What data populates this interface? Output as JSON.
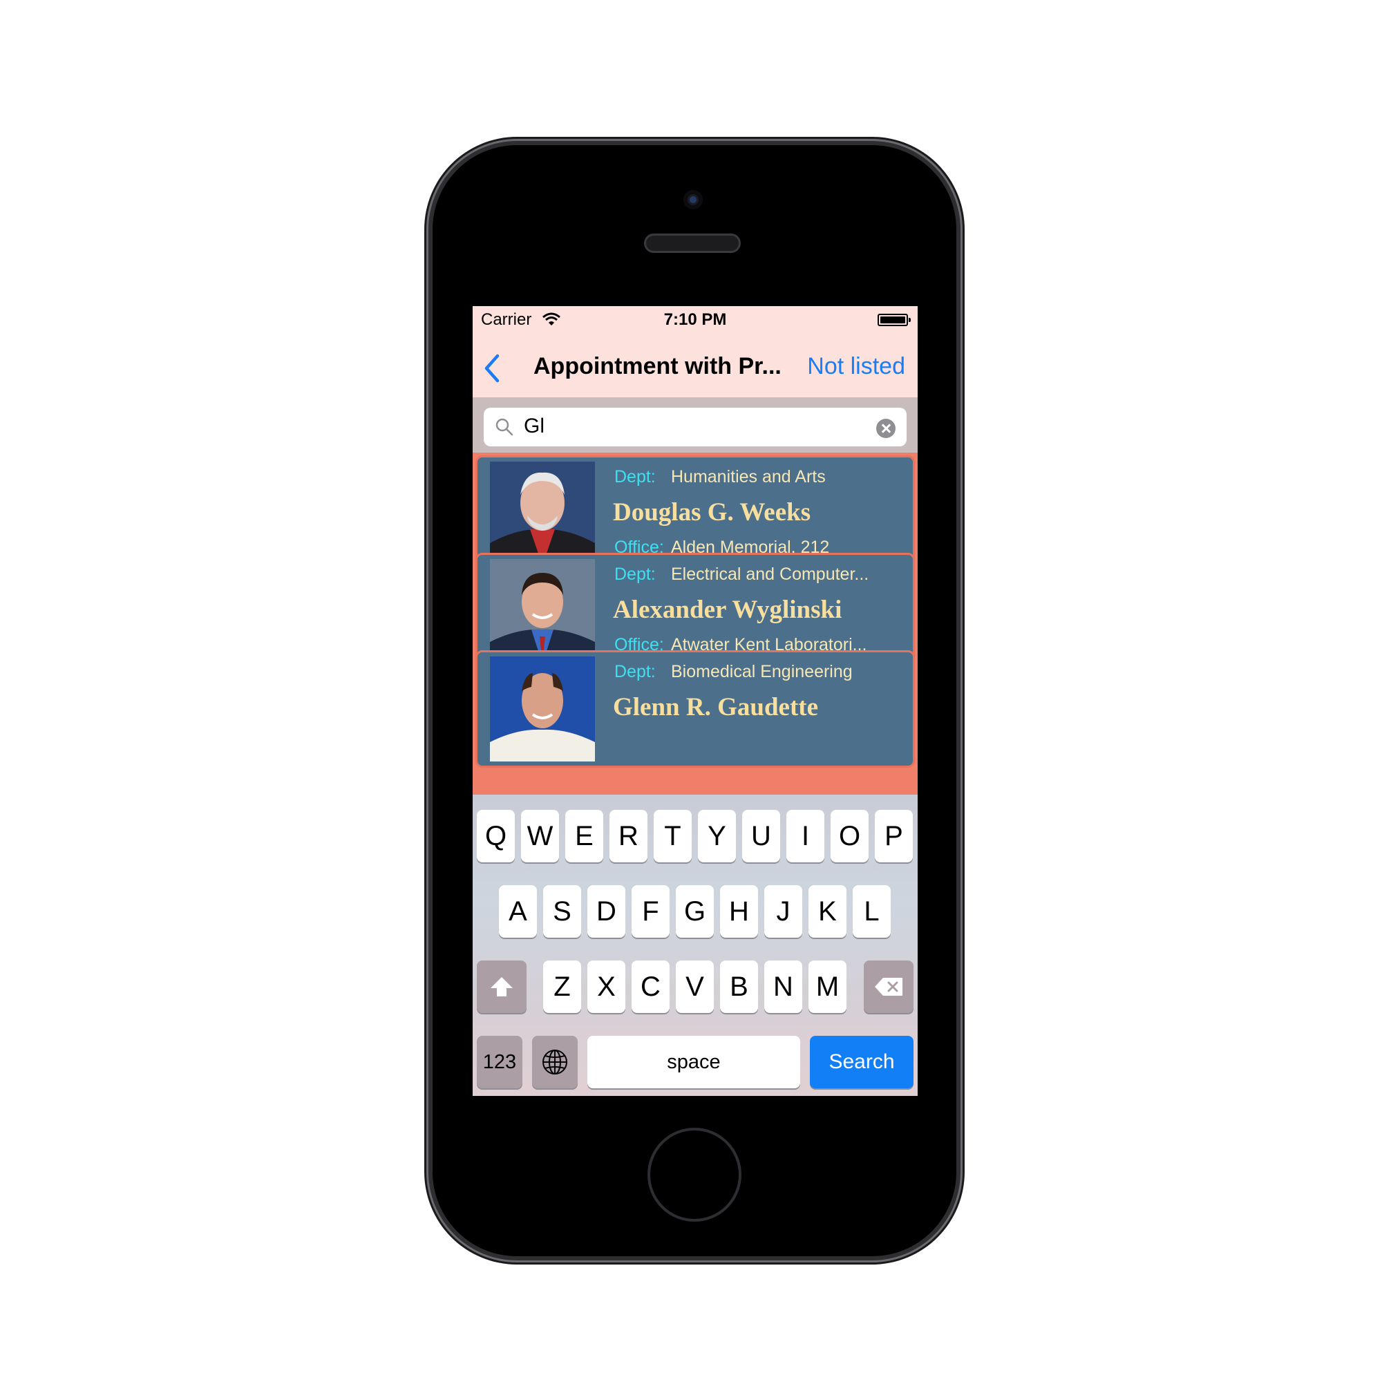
{
  "status_bar": {
    "carrier": "Carrier",
    "time": "7:10 PM"
  },
  "nav": {
    "title": "Appointment with Pr...",
    "right_button": "Not listed"
  },
  "search": {
    "value": "Gl"
  },
  "professors": [
    {
      "dept_label": "Dept:",
      "dept": "Humanities and Arts",
      "name": "Douglas G. Weeks",
      "office_label": "Office:",
      "office": "Alden Memorial, 212"
    },
    {
      "dept_label": "Dept:",
      "dept": "Electrical and Computer...",
      "name": "Alexander Wyglinski",
      "office_label": "Office:",
      "office": "Atwater Kent Laboratori..."
    },
    {
      "dept_label": "Dept:",
      "dept": "Biomedical Engineering",
      "name": "Glenn R. Gaudette",
      "office_label": "",
      "office": ""
    }
  ],
  "keyboard": {
    "row1": [
      "Q",
      "W",
      "E",
      "R",
      "T",
      "Y",
      "U",
      "I",
      "O",
      "P"
    ],
    "row2": [
      "A",
      "S",
      "D",
      "F",
      "G",
      "H",
      "J",
      "K",
      "L"
    ],
    "row3": [
      "Z",
      "X",
      "C",
      "V",
      "B",
      "N",
      "M"
    ],
    "numbers": "123",
    "space": "space",
    "search": "Search"
  },
  "colors": {
    "nav_background": "#fde1dc",
    "tint": "#1a7cf6",
    "row_background": "#4c6f8c",
    "row_border": "#f07f69",
    "label_cyan": "#3ee0f0",
    "name_gold": "#f9df9e"
  },
  "icons": [
    "wifi-icon",
    "battery-icon",
    "back-chevron-icon",
    "search-icon",
    "clear-icon",
    "shift-icon",
    "delete-icon",
    "globe-icon"
  ]
}
